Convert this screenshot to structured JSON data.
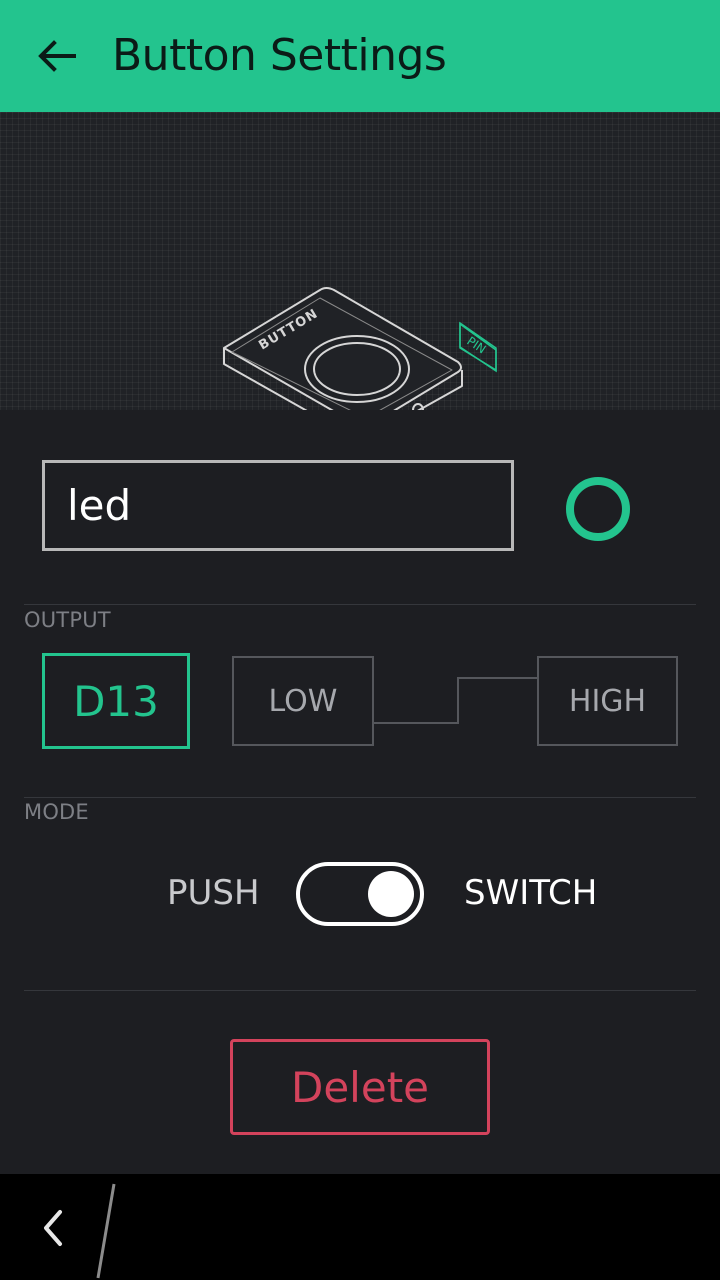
{
  "header": {
    "title": "Button Settings",
    "back_icon": "arrow-left-icon"
  },
  "preview": {
    "device_label": "BUTTON",
    "pin_label": "PIN"
  },
  "name_field": {
    "value": "led",
    "color": "#23c48e"
  },
  "output": {
    "section_label": "OUTPUT",
    "pin": "D13",
    "low_label": "LOW",
    "high_label": "HIGH"
  },
  "mode": {
    "section_label": "MODE",
    "left_label": "PUSH",
    "right_label": "SWITCH",
    "selected": "SWITCH"
  },
  "actions": {
    "delete_label": "Delete"
  },
  "colors": {
    "accent": "#23c48e",
    "danger": "#d3435c",
    "background": "#1d1e22"
  },
  "system_nav": {
    "back_icon": "chevron-left-icon"
  }
}
